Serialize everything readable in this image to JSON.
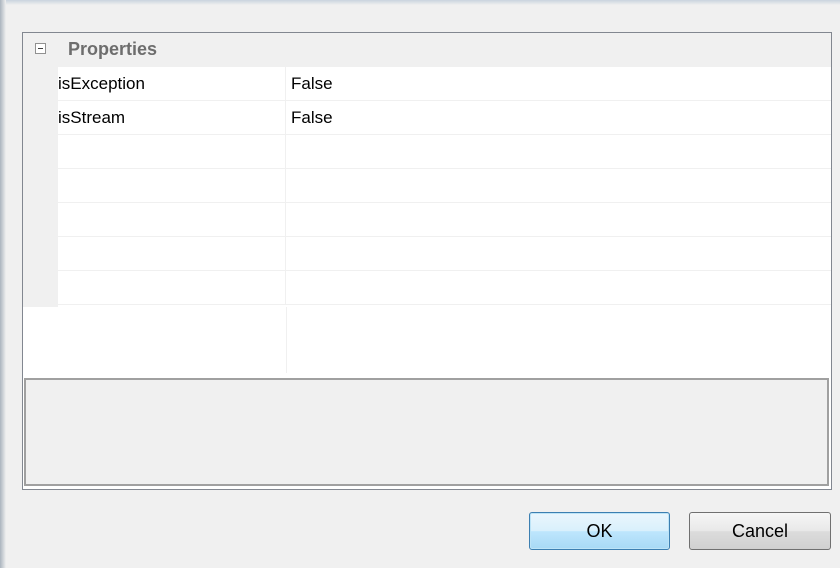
{
  "property_grid": {
    "category": {
      "label": "Properties",
      "toggle_icon": "collapse-minus-icon"
    },
    "rows": [
      {
        "name": "isException",
        "value": "False"
      },
      {
        "name": "isStream",
        "value": "False"
      },
      {
        "name": "",
        "value": ""
      },
      {
        "name": "",
        "value": ""
      },
      {
        "name": "",
        "value": ""
      },
      {
        "name": "",
        "value": ""
      },
      {
        "name": "",
        "value": ""
      }
    ],
    "description": ""
  },
  "buttons": {
    "ok_label": "OK",
    "cancel_label": "Cancel"
  }
}
